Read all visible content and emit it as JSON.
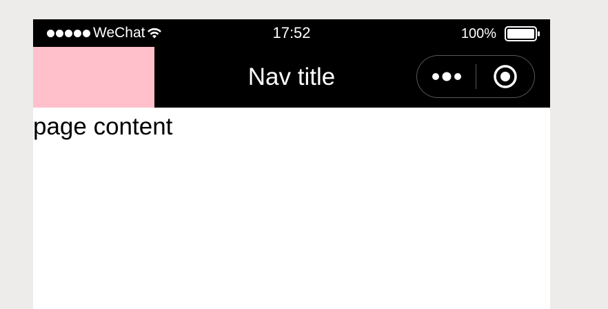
{
  "status_bar": {
    "carrier": "WeChat",
    "time": "17:52",
    "battery_percent": "100%",
    "battery_level": 1.0,
    "signal_bars": 5
  },
  "nav_bar": {
    "title": "Nav title",
    "left_block_color": "#ffc0cb",
    "background_color": "#000000",
    "capsule": {
      "menu_icon": "more-dots-icon",
      "close_icon": "target-close-icon"
    }
  },
  "page": {
    "content_text": "page content"
  }
}
